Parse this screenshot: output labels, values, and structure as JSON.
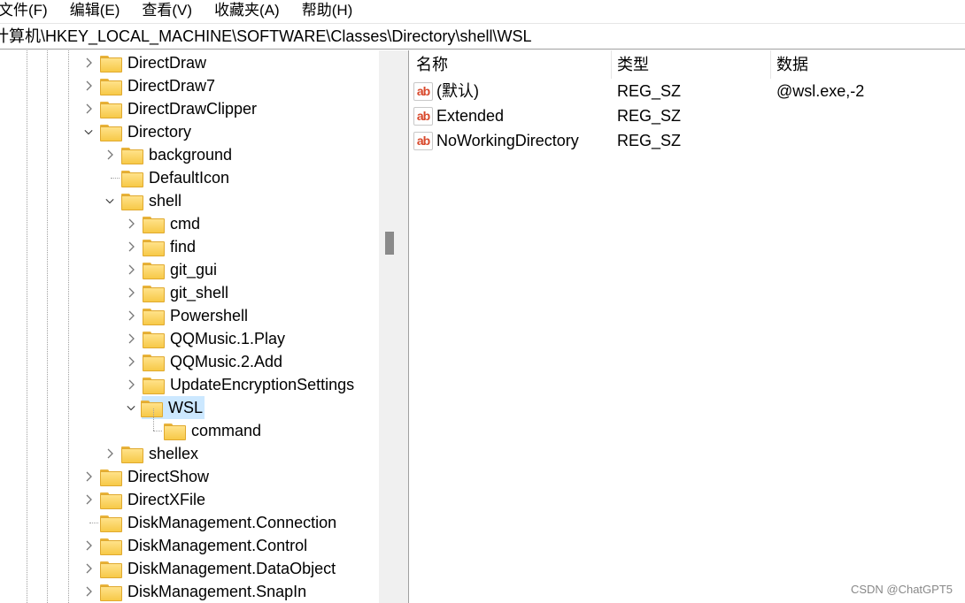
{
  "menu": [
    "文件(F)",
    "编辑(E)",
    "查看(V)",
    "收藏夹(A)",
    "帮助(H)"
  ],
  "address": "计算机\\HKEY_LOCAL_MACHINE\\SOFTWARE\\Classes\\Directory\\shell\\WSL",
  "tree": [
    {
      "label": "DirectDraw",
      "level": 0,
      "state": "collapsed"
    },
    {
      "label": "DirectDraw7",
      "level": 0,
      "state": "collapsed"
    },
    {
      "label": "DirectDrawClipper",
      "level": 0,
      "state": "collapsed"
    },
    {
      "label": "Directory",
      "level": 0,
      "state": "expanded"
    },
    {
      "label": "background",
      "level": 1,
      "state": "collapsed"
    },
    {
      "label": "DefaultIcon",
      "level": 1,
      "state": "leaf"
    },
    {
      "label": "shell",
      "level": 1,
      "state": "expanded"
    },
    {
      "label": "cmd",
      "level": 2,
      "state": "collapsed"
    },
    {
      "label": "find",
      "level": 2,
      "state": "collapsed"
    },
    {
      "label": "git_gui",
      "level": 2,
      "state": "collapsed"
    },
    {
      "label": "git_shell",
      "level": 2,
      "state": "collapsed"
    },
    {
      "label": "Powershell",
      "level": 2,
      "state": "collapsed"
    },
    {
      "label": "QQMusic.1.Play",
      "level": 2,
      "state": "collapsed"
    },
    {
      "label": "QQMusic.2.Add",
      "level": 2,
      "state": "collapsed"
    },
    {
      "label": "UpdateEncryptionSettings",
      "level": 2,
      "state": "collapsed"
    },
    {
      "label": "WSL",
      "level": 2,
      "state": "expanded",
      "selected": true
    },
    {
      "label": "command",
      "level": 3,
      "state": "leaf"
    },
    {
      "label": "shellex",
      "level": 1,
      "state": "collapsed"
    },
    {
      "label": "DirectShow",
      "level": 0,
      "state": "collapsed"
    },
    {
      "label": "DirectXFile",
      "level": 0,
      "state": "collapsed"
    },
    {
      "label": "DiskManagement.Connection",
      "level": 0,
      "state": "leaf"
    },
    {
      "label": "DiskManagement.Control",
      "level": 0,
      "state": "collapsed"
    },
    {
      "label": "DiskManagement.DataObject",
      "level": 0,
      "state": "collapsed"
    },
    {
      "label": "DiskManagement.SnapIn",
      "level": 0,
      "state": "collapsed"
    }
  ],
  "list": {
    "headers": [
      "名称",
      "类型",
      "数据"
    ],
    "rows": [
      {
        "name": "(默认)",
        "type": "REG_SZ",
        "data": "@wsl.exe,-2",
        "icon": "string-value-icon"
      },
      {
        "name": "Extended",
        "type": "REG_SZ",
        "data": "",
        "icon": "string-value-icon"
      },
      {
        "name": "NoWorkingDirectory",
        "type": "REG_SZ",
        "data": "",
        "icon": "string-value-icon"
      }
    ]
  },
  "watermark": "CSDN @ChatGPT5",
  "colors": {
    "selection": "#cce8ff",
    "folder": "#f7c948",
    "string_icon": "#d8482b"
  }
}
